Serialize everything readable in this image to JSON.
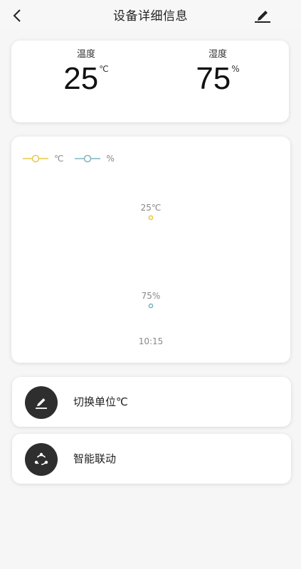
{
  "header": {
    "title": "设备详细信息",
    "back_icon": "chevron-left-icon",
    "edit_icon": "pencil-icon"
  },
  "readings": {
    "temperature": {
      "label": "温度",
      "value": "25",
      "unit": "℃"
    },
    "humidity": {
      "label": "湿度",
      "value": "75",
      "unit": "%"
    }
  },
  "chart": {
    "legend": [
      {
        "label": "℃",
        "color": "#e9c84a"
      },
      {
        "label": "%",
        "color": "#7fb5bf"
      }
    ]
  },
  "chart_data": {
    "type": "line",
    "x": [
      "10:15"
    ],
    "series": [
      {
        "name": "℃",
        "values": [
          25
        ],
        "color": "#e9c84a",
        "data_labels": [
          "25℃"
        ]
      },
      {
        "name": "%",
        "values": [
          75
        ],
        "color": "#7fb5bf",
        "data_labels": [
          "75%"
        ]
      }
    ],
    "xlabel": "",
    "ylabel": "",
    "grid": false,
    "legend_position": "top-left"
  },
  "actions": {
    "switch_unit": {
      "label": "切换单位℃",
      "icon": "pencil-icon"
    },
    "smart_link": {
      "label": "智能联动",
      "icon": "share-icon"
    }
  }
}
